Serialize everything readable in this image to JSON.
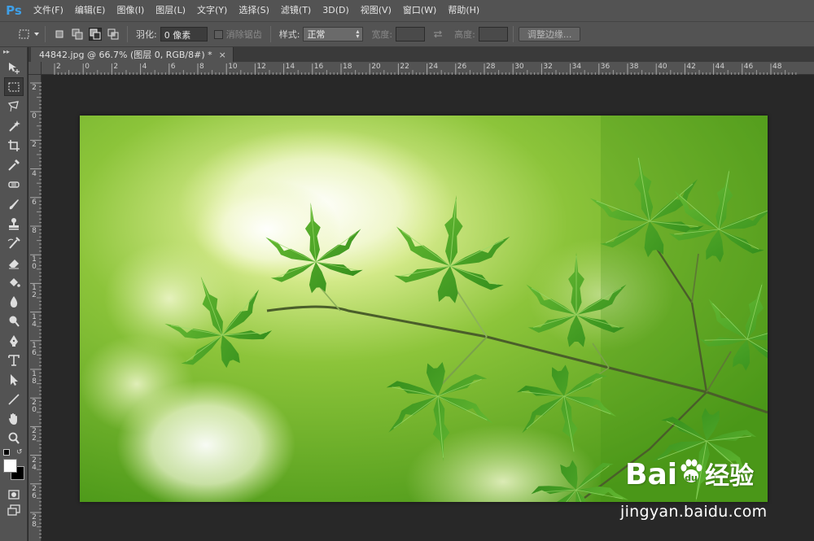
{
  "app": {
    "logo": "Ps"
  },
  "menu": {
    "items": [
      "文件(F)",
      "编辑(E)",
      "图像(I)",
      "图层(L)",
      "文字(Y)",
      "选择(S)",
      "滤镜(T)",
      "3D(D)",
      "视图(V)",
      "窗口(W)",
      "帮助(H)"
    ]
  },
  "options": {
    "feather_label": "羽化:",
    "feather_value": "0 像素",
    "antialias_label": "消除锯齿",
    "style_label": "样式:",
    "style_value": "正常",
    "width_label": "宽度:",
    "height_label": "高度:",
    "refine_edge_label": "调整边缘..."
  },
  "document": {
    "tab_title": "44842.jpg @ 66.7% (图层 0, RGB/8#) *",
    "close_glyph": "×"
  },
  "rulers": {
    "horizontal": [
      "2",
      "0",
      "2",
      "4",
      "6",
      "8",
      "10",
      "12",
      "14",
      "16",
      "18",
      "20",
      "22",
      "24",
      "26",
      "28",
      "30",
      "32",
      "34",
      "36",
      "38",
      "40",
      "42",
      "44",
      "46",
      "48"
    ],
    "vertical": [
      "2",
      "0",
      "2",
      "4",
      "6",
      "8",
      "10",
      "12",
      "14",
      "16",
      "18",
      "20",
      "22",
      "24",
      "26",
      "28"
    ]
  },
  "tools": [
    {
      "name": "move-tool-icon"
    },
    {
      "name": "rectangular-marquee-tool-icon",
      "active": true
    },
    {
      "name": "lasso-tool-icon"
    },
    {
      "name": "magic-wand-tool-icon"
    },
    {
      "name": "crop-tool-icon"
    },
    {
      "name": "eyedropper-tool-icon"
    },
    {
      "name": "spot-healing-brush-icon"
    },
    {
      "name": "brush-tool-icon"
    },
    {
      "name": "clone-stamp-tool-icon"
    },
    {
      "name": "history-brush-tool-icon"
    },
    {
      "name": "eraser-tool-icon"
    },
    {
      "name": "paint-bucket-tool-icon"
    },
    {
      "name": "blur-tool-icon"
    },
    {
      "name": "dodge-tool-icon"
    },
    {
      "name": "pen-tool-icon"
    },
    {
      "name": "type-tool-icon"
    },
    {
      "name": "path-selection-tool-icon"
    },
    {
      "name": "line-tool-icon"
    },
    {
      "name": "hand-tool-icon"
    },
    {
      "name": "zoom-tool-icon"
    }
  ],
  "watermark": {
    "logo_text": "Bai",
    "logo_du": "du",
    "logo_cn": "经验",
    "url": "jingyan.baidu.com"
  },
  "colors": {
    "ps_blue": "#3fa0e8",
    "panel": "#535353",
    "canvas_bg": "#282828",
    "leaf_green": "#3e9a1c"
  }
}
